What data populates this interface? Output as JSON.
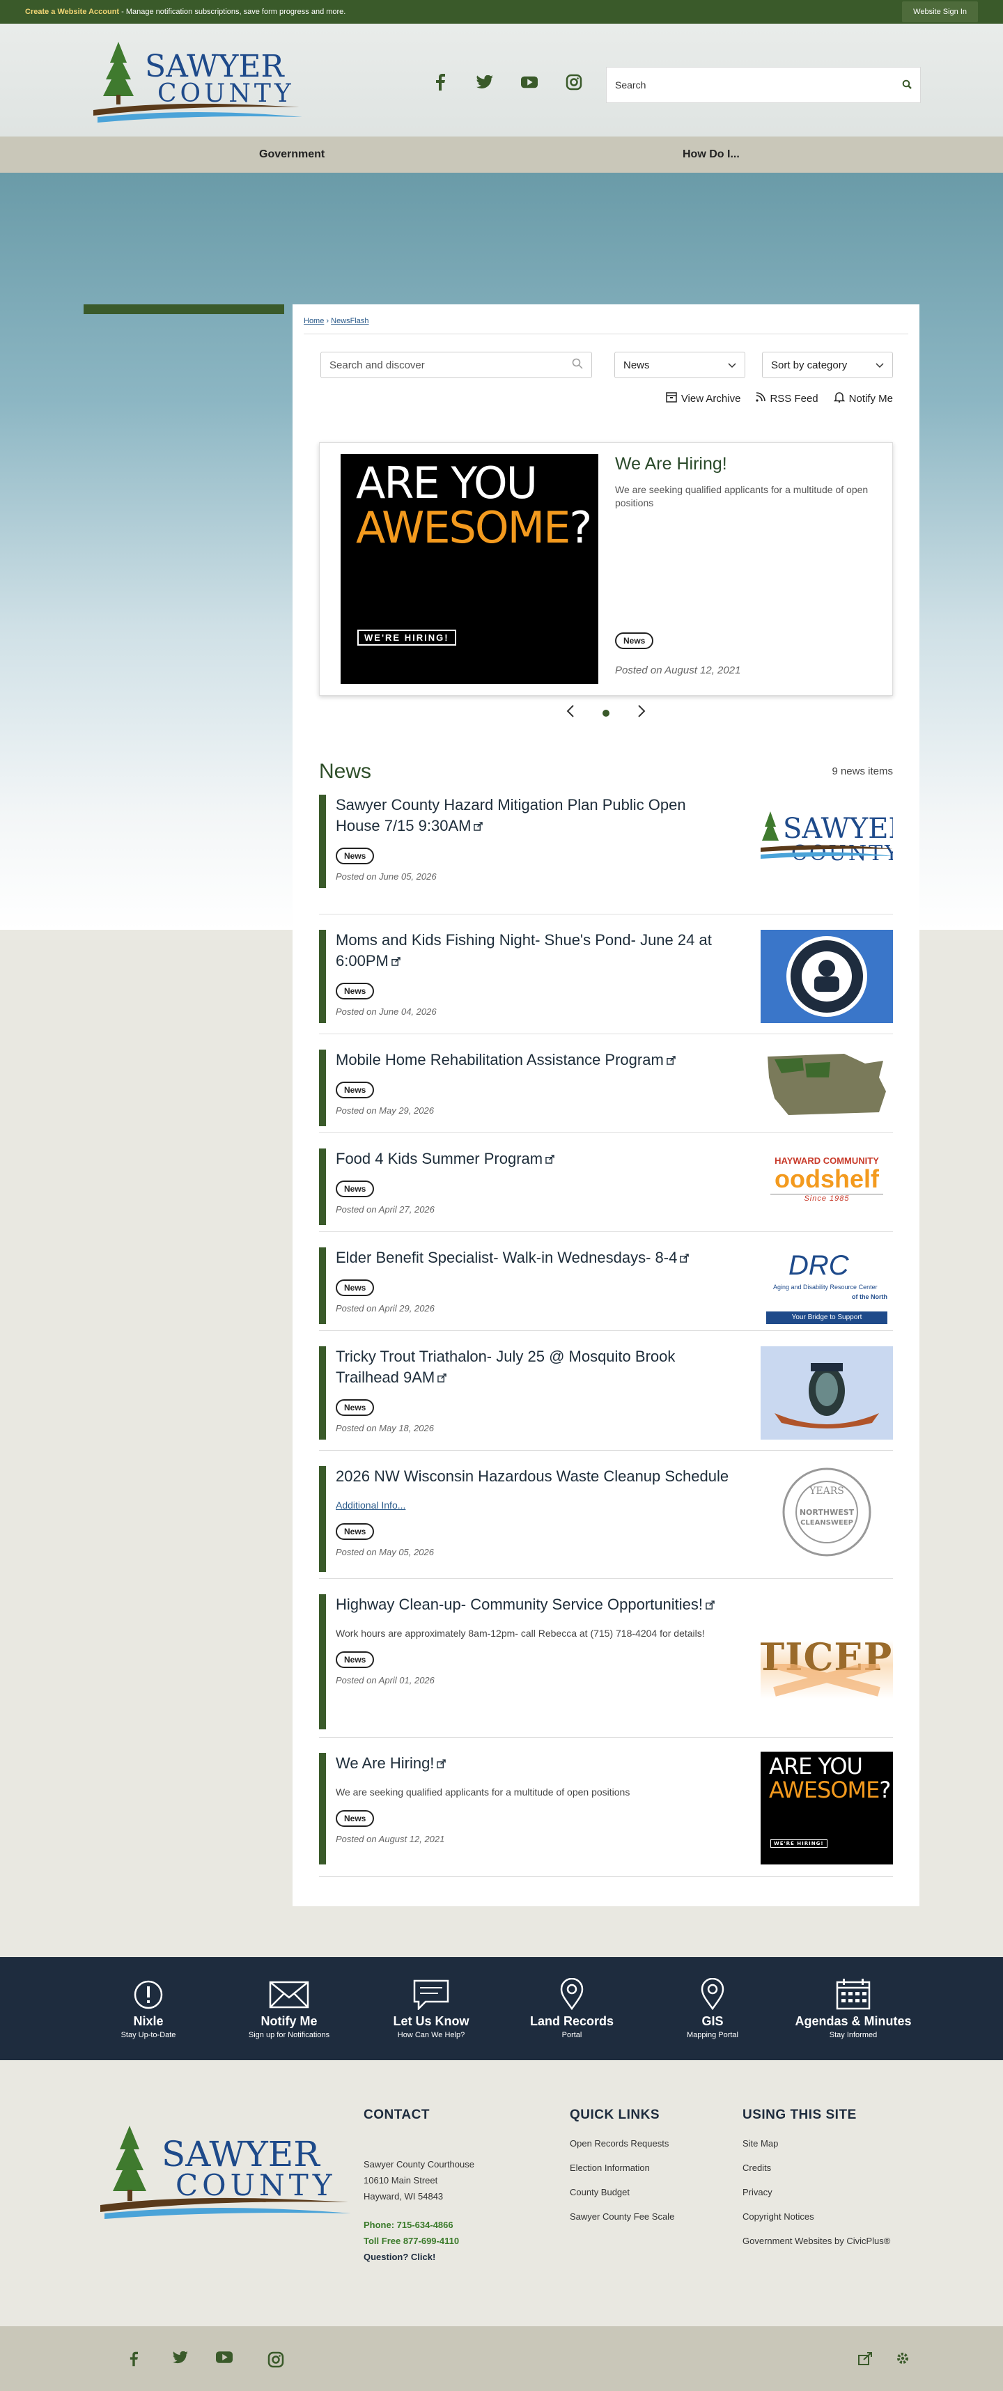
{
  "topbar": {
    "create_account": "Create a Website Account",
    "manage": " - Manage notification subscriptions, save form progress and more.",
    "signin": "Website Sign In"
  },
  "header": {
    "logo_line1": "SAWYER",
    "logo_line2": "COUNTY",
    "search_placeholder": "Search"
  },
  "nav": {
    "items": [
      "Government",
      "How Do I..."
    ]
  },
  "breadcrumb": {
    "home": "Home",
    "sep": "›",
    "current": "NewsFlash"
  },
  "filters": {
    "search_placeholder": "Search and discover",
    "category": "News",
    "sort": "Sort by category"
  },
  "actions": {
    "archive": "View Archive",
    "rss": "RSS Feed",
    "notify": "Notify Me"
  },
  "featured": {
    "title": "We Are Hiring!",
    "desc": "We are seeking qualified applicants for a multitude of open positions",
    "tag": "News",
    "posted": "Posted on August 12, 2021",
    "img_line1": "ARE YOU",
    "img_line2": "AWESOME",
    "img_q": "?",
    "img_badge": "WE'RE HIRING!"
  },
  "news": {
    "title": "News",
    "count": "9 news items",
    "items": [
      {
        "title": "Sawyer County Hazard Mitigation Plan Public Open House 7/15 9:30AM",
        "tag": "News",
        "posted": "Posted on June 05, 2026",
        "thumb": "logo"
      },
      {
        "title": "Moms and Kids Fishing Night- Shue's Pond- June 24 at 6:00PM",
        "tag": "News",
        "posted": "Posted on June 04, 2026",
        "thumb": "badge"
      },
      {
        "title": "Mobile Home Rehabilitation Assistance Program",
        "tag": "News",
        "posted": "Posted on May 29, 2026",
        "thumb": "map"
      },
      {
        "title": "Food 4 Kids Summer Program",
        "tag": "News",
        "posted": "Posted on April 27, 2026",
        "thumb": "foodshelf",
        "thumb_line1": "HAYWARD COMMUNITY",
        "thumb_line2": "oodshelf",
        "thumb_line3": "Since 1985"
      },
      {
        "title": "Elder Benefit Specialist- Walk-in Wednesdays- 8-4",
        "tag": "News",
        "posted": "Posted on April 29, 2026",
        "thumb": "adrc",
        "thumb_line1": "DRC",
        "thumb_line2": "Aging and Disability Resource Center",
        "thumb_line3": "of the North",
        "thumb_line4": "Your Bridge to Support"
      },
      {
        "title": "Tricky Trout Triathalon- July 25 @ Mosquito Brook Trailhead 9AM",
        "tag": "News",
        "posted": "Posted on May 18, 2026",
        "thumb": "trout"
      },
      {
        "title": "2026 NW Wisconsin Hazardous Waste Cleanup Schedule",
        "tag": "News",
        "posted": "Posted on May 05, 2026",
        "sub": "Additional Info...",
        "sub_link": true,
        "thumb": "seal",
        "thumb_line1": "YEARS",
        "thumb_line2": "NORTHWEST",
        "thumb_line3": "CLEANSWEEP"
      },
      {
        "title": "Highway Clean-up- Community Service Opportunities!",
        "tag": "News",
        "posted": "Posted on April 01, 2026",
        "sub": "Work hours are approximately 8am-12pm- call Rebecca at (715) 718-4204 for details!",
        "thumb": "justice",
        "thumb_line1": "TICEPO"
      },
      {
        "title": "We Are Hiring!",
        "tag": "News",
        "posted": "Posted on August 12, 2021",
        "sub": "We are seeking qualified applicants for a multitude of open positions",
        "thumb": "awesome"
      }
    ]
  },
  "band": [
    {
      "label": "Nixle",
      "sub": "Stay Up-to-Date",
      "icon": "alert-icon"
    },
    {
      "label": "Notify Me",
      "sub": "Sign up for Notifications",
      "icon": "envelope-icon"
    },
    {
      "label": "Let Us Know",
      "sub": "How Can We Help?",
      "icon": "chat-icon"
    },
    {
      "label": "Land Records",
      "sub": "Portal",
      "icon": "map-pin-icon"
    },
    {
      "label": "GIS",
      "sub": "Mapping Portal",
      "icon": "location-icon"
    },
    {
      "label": "Agendas & Minutes",
      "sub": "Stay Informed",
      "icon": "calendar-icon"
    }
  ],
  "footer": {
    "contact_title": "CONTACT",
    "address1": "Sawyer County Courthouse",
    "address2": "10610 Main Street",
    "address3": "Hayward, WI 54843",
    "phone": "Phone: 715-634-4866",
    "tollfree": "Toll Free 877-699-4110",
    "question": "Question? Click!",
    "quick_title": "QUICK LINKS",
    "quick_links": [
      "Open Records Requests",
      "Election Information",
      "County Budget",
      "Sawyer County Fee Scale"
    ],
    "using_title": "USING THIS SITE",
    "using_links": [
      "Site Map",
      "Credits",
      "Privacy",
      "Copyright Notices",
      "Government Websites by CivicPlus®"
    ]
  },
  "colors": {
    "brand_green": "#3a5a2a",
    "navy": "#1e2c3e",
    "tan": "#c9c7b9",
    "logo_blue": "#1e4a8a",
    "accent_orange": "#f39a1e"
  }
}
